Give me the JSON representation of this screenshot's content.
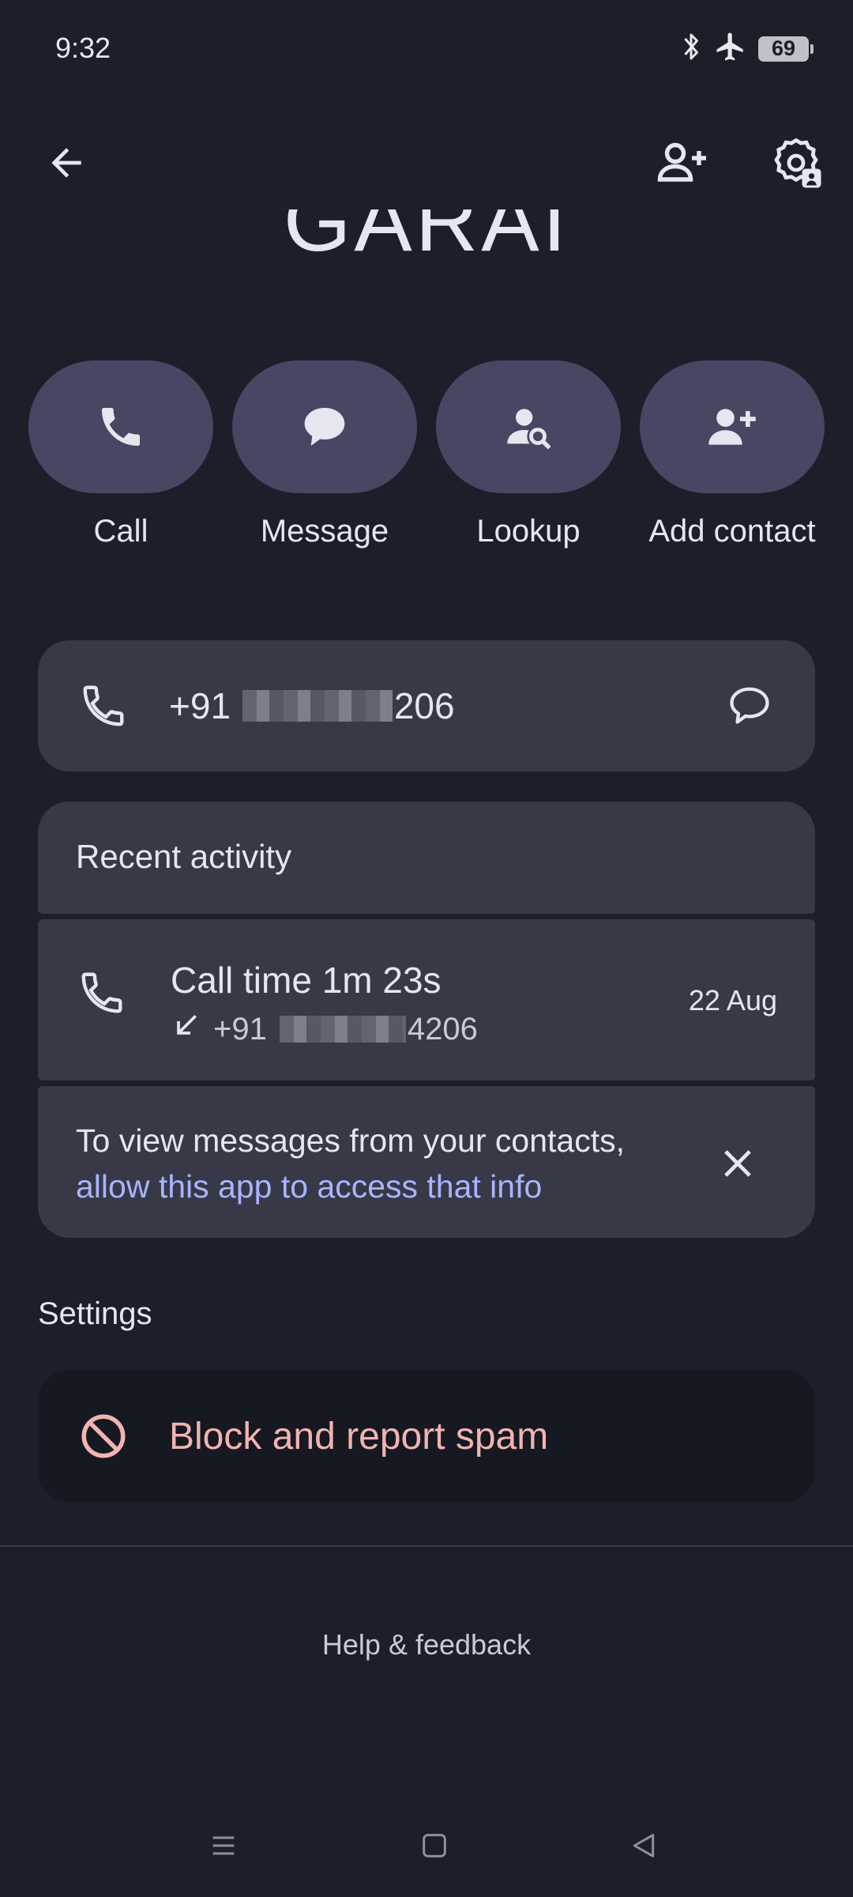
{
  "status_bar": {
    "time": "9:32",
    "battery": "69"
  },
  "contact": {
    "name": "GARAI"
  },
  "actions": [
    {
      "label": "Call",
      "icon": "phone-icon"
    },
    {
      "label": "Message",
      "icon": "message-icon"
    },
    {
      "label": "Lookup",
      "icon": "person-search-icon"
    },
    {
      "label": "Add contact",
      "icon": "person-add-icon"
    }
  ],
  "phone": {
    "prefix": "+91",
    "suffix": "206",
    "suffix_lead": "4"
  },
  "recent_activity": {
    "title": "Recent activity",
    "call_time": "Call time 1m 23s",
    "number_prefix": "+91",
    "number_suffix": "4206",
    "date": "22 Aug"
  },
  "permission_prompt": {
    "text": "To view messages from your contacts,",
    "link": "allow this app to access that info"
  },
  "settings": {
    "title": "Settings",
    "block_label": "Block and report spam"
  },
  "footer": {
    "help": "Help & feedback"
  },
  "colors": {
    "background": "#1c1e2a",
    "pill": "#474764",
    "card": "#373947",
    "link": "#a9b4ff",
    "danger": "#f2b4b0"
  }
}
